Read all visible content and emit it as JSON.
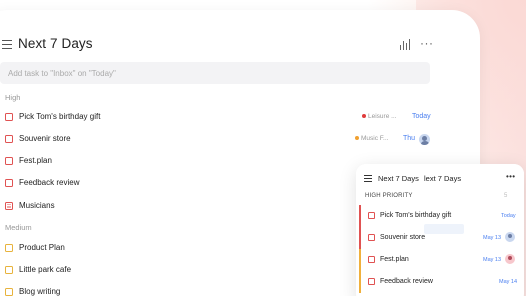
{
  "header": {
    "title": "Next 7 Days",
    "more_glyph": "···"
  },
  "add_task": {
    "placeholder": "Add task to \"Inbox\" on \"Today\""
  },
  "sections": {
    "high": "High",
    "medium": "Medium"
  },
  "tasks_high": [
    {
      "label": "Pick Tom's birthday gift",
      "tag": "Leisure ...",
      "tag_color": "#e03c3c",
      "date": "Today",
      "check": "red"
    },
    {
      "label": "Souvenir store",
      "tag": "Music F...",
      "tag_color": "#f0a030",
      "date": "Thu",
      "check": "red",
      "avatar": true
    },
    {
      "label": "Fest.plan",
      "check": "red"
    },
    {
      "label": "Feedback review",
      "check": "red"
    },
    {
      "label": "Musicians",
      "check": "red-list"
    }
  ],
  "tasks_medium": [
    {
      "label": "Product Plan",
      "check": "yellow"
    },
    {
      "label": "Little park cafe",
      "check": "yellow"
    },
    {
      "label": "Blog writing",
      "check": "yellow"
    }
  ],
  "phone": {
    "title": "Next 7 Days",
    "title_echo": "lext 7 Days",
    "more_glyph": "•••",
    "section": "HIGH PRIORITY",
    "count": "5",
    "rows": [
      {
        "label": "Pick Tom's birthday gift",
        "date": "Today",
        "bar_color": "#e05252"
      },
      {
        "label": "Souvenir store",
        "date": "May 13",
        "bar_color": "#e05252"
      },
      {
        "label": "Fest.plan",
        "date": "May 13",
        "bar_color": "#f0b03c"
      },
      {
        "label": "Feedback review",
        "date": "May 14",
        "bar_color": "#f0b03c"
      }
    ]
  },
  "colors": {
    "accent": "#4a7ff0",
    "high": "#e05252",
    "medium": "#e8b33c"
  }
}
